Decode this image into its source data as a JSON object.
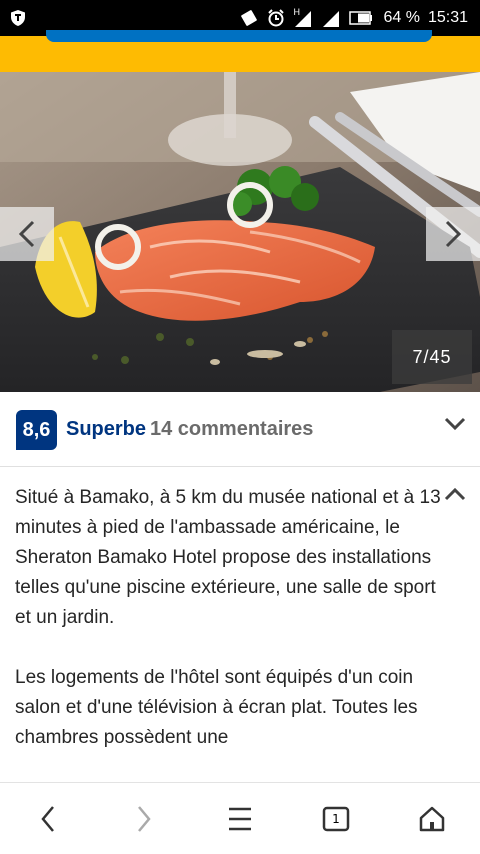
{
  "status_bar": {
    "battery": "64 %",
    "time": "15:31",
    "network_label": "H"
  },
  "gallery": {
    "counter": "7/45"
  },
  "rating": {
    "score": "8,6",
    "word": "Superbe",
    "reviews": "14 commentaires"
  },
  "description": {
    "paragraph1": "Situé à Bamako, à 5 km du musée national et à 13 minutes à pied de l'ambassade américaine, le Sheraton Bamako Hotel propose des installations telles qu'une piscine extérieure, une salle de sport et un jardin.",
    "paragraph2": "Les logements de l'hôtel sont équipés d'un coin salon et d'une télévision à écran plat. Toutes les chambres possèdent une"
  },
  "bottom_bar": {
    "tab_count": "1"
  },
  "colors": {
    "brand_yellow": "#febb02",
    "brand_blue": "#003580",
    "link_blue": "#0071c2"
  },
  "icons": [
    "shield-icon",
    "signal-icon",
    "alarm-icon",
    "battery-icon",
    "chevron-left-icon",
    "chevron-right-icon",
    "chevron-down-icon",
    "chevron-up-icon",
    "back-icon",
    "forward-icon",
    "menu-icon",
    "tabs-icon",
    "home-icon"
  ]
}
